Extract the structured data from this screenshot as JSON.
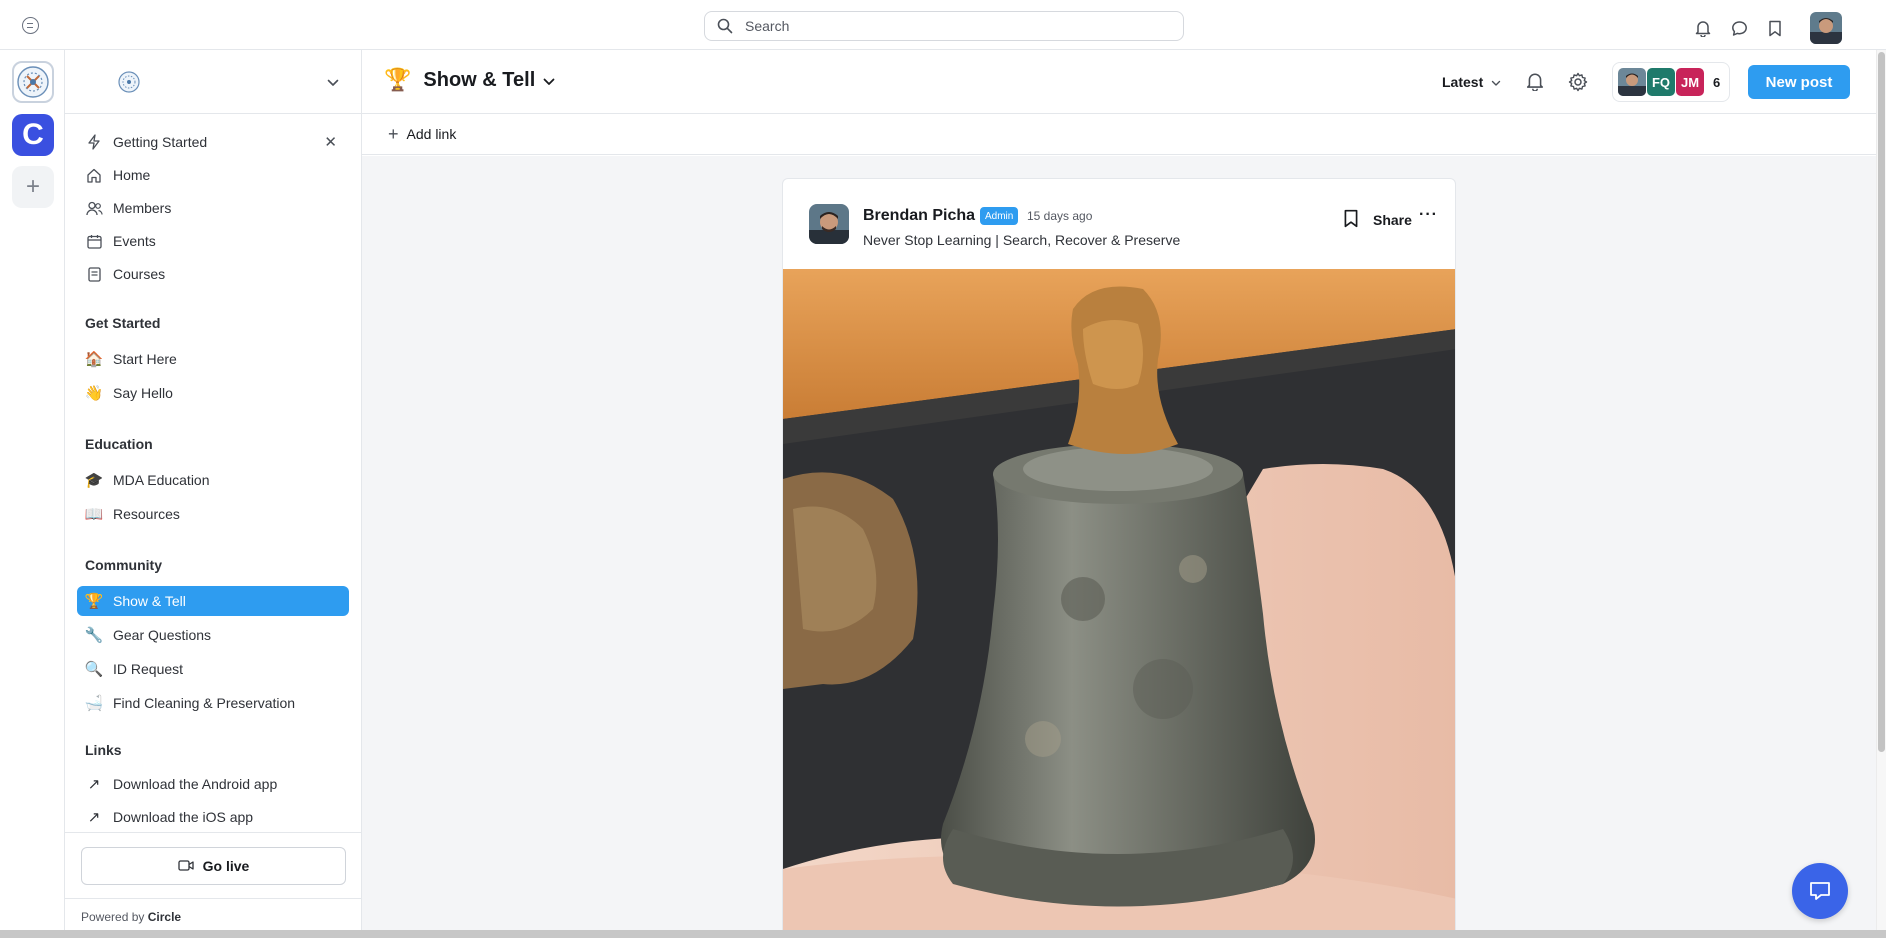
{
  "topbar": {
    "search_placeholder": "Search"
  },
  "sidebar": {
    "pinned": [
      {
        "label": "Getting Started",
        "icon": "lightning-icon"
      },
      {
        "label": "Home",
        "icon": "home-icon"
      },
      {
        "label": "Members",
        "icon": "members-icon"
      },
      {
        "label": "Events",
        "icon": "calendar-icon"
      },
      {
        "label": "Courses",
        "icon": "courses-icon"
      }
    ],
    "sections": [
      {
        "title": "Get Started",
        "items": [
          {
            "label": "Start Here",
            "emoji": "🏠"
          },
          {
            "label": "Say Hello",
            "emoji": "👋"
          }
        ]
      },
      {
        "title": "Education",
        "items": [
          {
            "label": "MDA Education",
            "emoji": "🎓"
          },
          {
            "label": "Resources",
            "emoji": "📖"
          }
        ]
      },
      {
        "title": "Community",
        "items": [
          {
            "label": "Show & Tell",
            "emoji": "🏆"
          },
          {
            "label": "Gear Questions",
            "emoji": "🔧"
          },
          {
            "label": "ID Request",
            "emoji": "🔍"
          },
          {
            "label": "Find Cleaning & Preservation",
            "emoji": "🛁"
          }
        ]
      },
      {
        "title": "Links",
        "items": [
          {
            "label": "Download the Android app",
            "emoji": "↗"
          },
          {
            "label": "Download the iOS app",
            "emoji": "↗"
          }
        ]
      }
    ],
    "go_live_label": "Go live",
    "powered_by": "Powered by",
    "powered_brand": "Circle"
  },
  "header": {
    "space_emoji": "🏆",
    "space_title": "Show & Tell",
    "sort_label": "Latest",
    "member_initials": [
      "FQ",
      "JM"
    ],
    "member_count": "6",
    "new_post_label": "New post",
    "add_link_label": "Add link"
  },
  "post": {
    "author": "Brendan Picha",
    "badge": "Admin",
    "time": "15 days ago",
    "headline": "Never Stop Learning | Search, Recover & Preserve",
    "share_label": "Share",
    "more_label": "···"
  },
  "colors": {
    "accent": "#2e9cf0",
    "circle_blue": "#3a50e0",
    "chat_blue": "#3a64e8",
    "member_fq": "#1f7a6b",
    "member_jm": "#c8245a"
  }
}
